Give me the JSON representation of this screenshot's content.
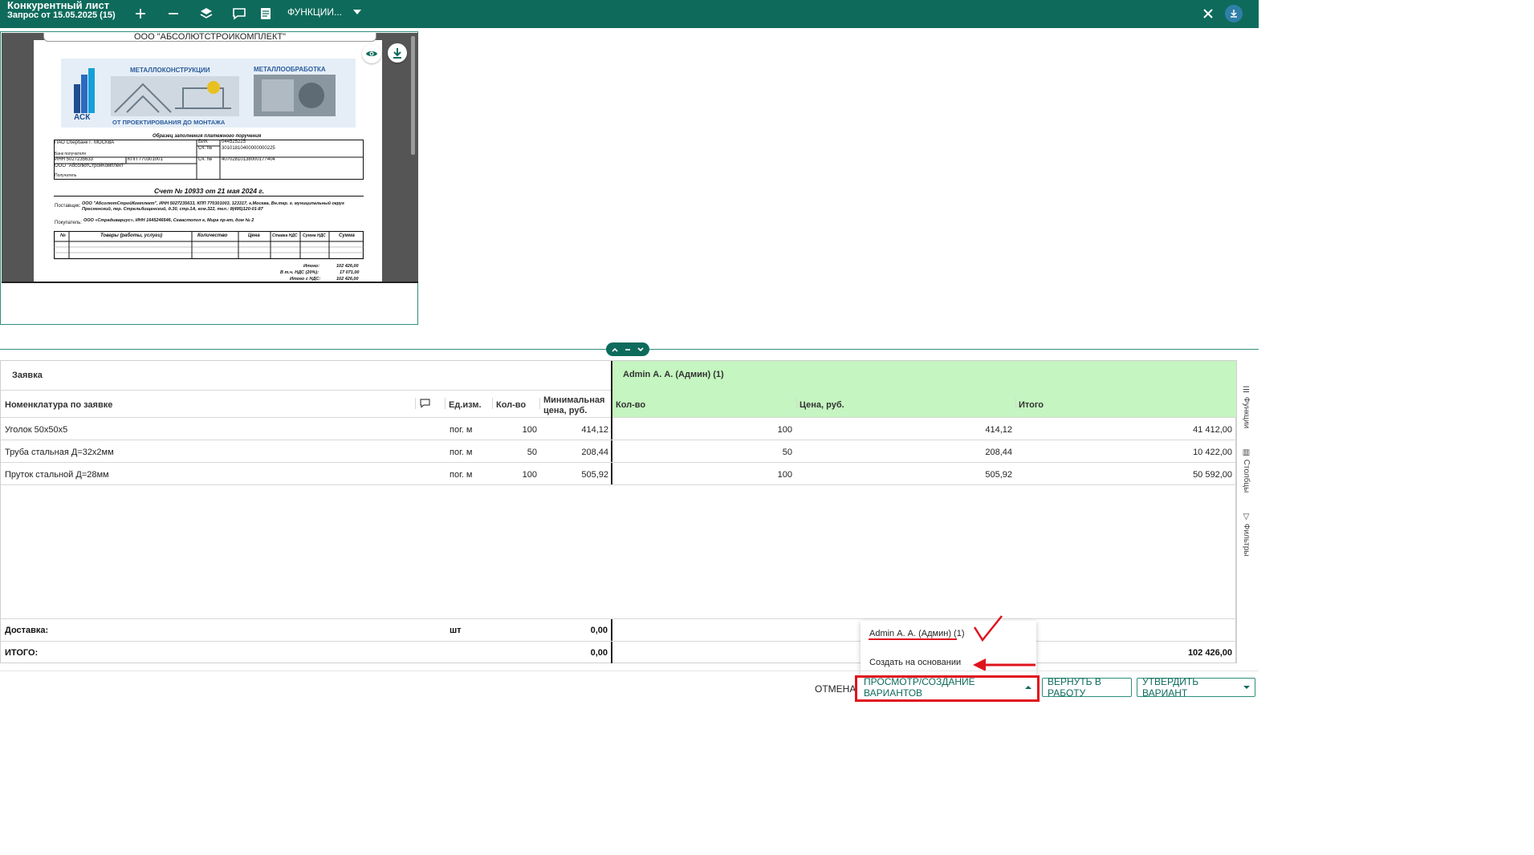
{
  "header": {
    "title": "Конкурентный лист",
    "subtitle": "Запрос от 15.05.2025 (15)",
    "functions_label": "ФУНКЦИИ..."
  },
  "preview": {
    "doc_title": "ООО \"АБСОЛЮТСТРОЙКОМПЛЕКТ\"",
    "banner_left": "МЕТАЛЛОКОНСТРУКЦИИ",
    "banner_right": "МЕТАЛЛООБРАБОТКА",
    "banner_bottom": "ОТ ПРОЕКТИРОВАНИЯ ДО МОНТАЖА",
    "logo": "АСК",
    "form_title": "Образец заполнения платежного поручения",
    "bank": "ПАО Сбербанк Г. МОСКВА",
    "bik_label": "БИК",
    "bik": "044525225",
    "acc_label": "Сч. №",
    "acc1": "30101810400000000225",
    "recipient_bank_label": "Банк получателя",
    "inn_line": "ИНН   5027235633",
    "kpp_line": "КПП   770301001",
    "acc2": "40702810138000177404",
    "org": "ООО \"АбсолютСтройКомплект\"",
    "recipient_label": "Получатель",
    "invoice": "Счет № 10933 от 21 мая 2024 г.",
    "supplier_label": "Поставщик:",
    "supplier": "ООО \"АбсолютСтройКомплект\", ИНН 5027235633, КПП 770301003, 123317, г.Москва, Вн.тер. г. муниципальный округ Пресненский, пер. Стрельбищенский, д.30, стр.1А, ком.322, тел.: 8(495)120-01-87",
    "buyer_label": "Покупатель:",
    "buyer": "ООО «Страдивариус», ИНН 1645246546, Севастопол  г, Мира пр-кт, дом № 2",
    "table_headers": [
      "№",
      "Товары (работы, услуги)",
      "Количество",
      "Цена",
      "Ставка НДС",
      "Сумма НДС",
      "Сумма"
    ],
    "total_label": "Итого:",
    "total": "102 426,00",
    "vat_label": "В т.ч. НДС (20%):",
    "vat": "17 071,00",
    "total_vat_label": "Итого с НДС:",
    "total_vat": "102 426,00"
  },
  "grid": {
    "group_left": "Заявка",
    "group_right": "Admin А. А. (Админ) (1)",
    "col_nomenclature": "Номенклатура по заявке",
    "col_unit": "Ед.изм.",
    "col_qty": "Кол-во",
    "col_minprice_1": "Минимальная",
    "col_minprice_2": "цена, руб.",
    "col_r_qty": "Кол-во",
    "col_r_price": "Цена, руб.",
    "col_r_total": "Итого",
    "rows": [
      {
        "name": "Уголок 50х50х5",
        "unit": "пог. м",
        "qty": "100",
        "minprice": "414,12",
        "r_qty": "100",
        "r_price": "414,12",
        "r_total": "41 412,00"
      },
      {
        "name": "Труба стальная Д=32х2мм",
        "unit": "пог. м",
        "qty": "50",
        "minprice": "208,44",
        "r_qty": "50",
        "r_price": "208,44",
        "r_total": "10 422,00"
      },
      {
        "name": "Пруток стальной Д=28мм",
        "unit": "пог. м",
        "qty": "100",
        "minprice": "505,92",
        "r_qty": "100",
        "r_price": "505,92",
        "r_total": "50 592,00"
      }
    ],
    "delivery_label": "Доставка:",
    "delivery_unit": "шт",
    "delivery_value": "0,00",
    "total_label": "ИТОГО:",
    "total_value": "0,00",
    "total_right": "102 426,00"
  },
  "side_panel": {
    "functions": "Функции",
    "columns": "Столбцы",
    "filters": "Фильтры"
  },
  "popup": {
    "item1": "Admin А. А. (Админ) (1)",
    "item2": "Создать на основании"
  },
  "footer": {
    "cancel": "ОТМЕНА",
    "view_create": "ПРОСМОТР/СОЗДАНИЕ ВАРИАНТОВ",
    "return": "ВЕРНУТЬ В РАБОТУ",
    "approve": "УТВЕРДИТЬ ВАРИАНТ"
  },
  "colors": {
    "brand": "#0e6b5c",
    "highlight": "#c5f5c0",
    "annotation": "#e0121c"
  }
}
